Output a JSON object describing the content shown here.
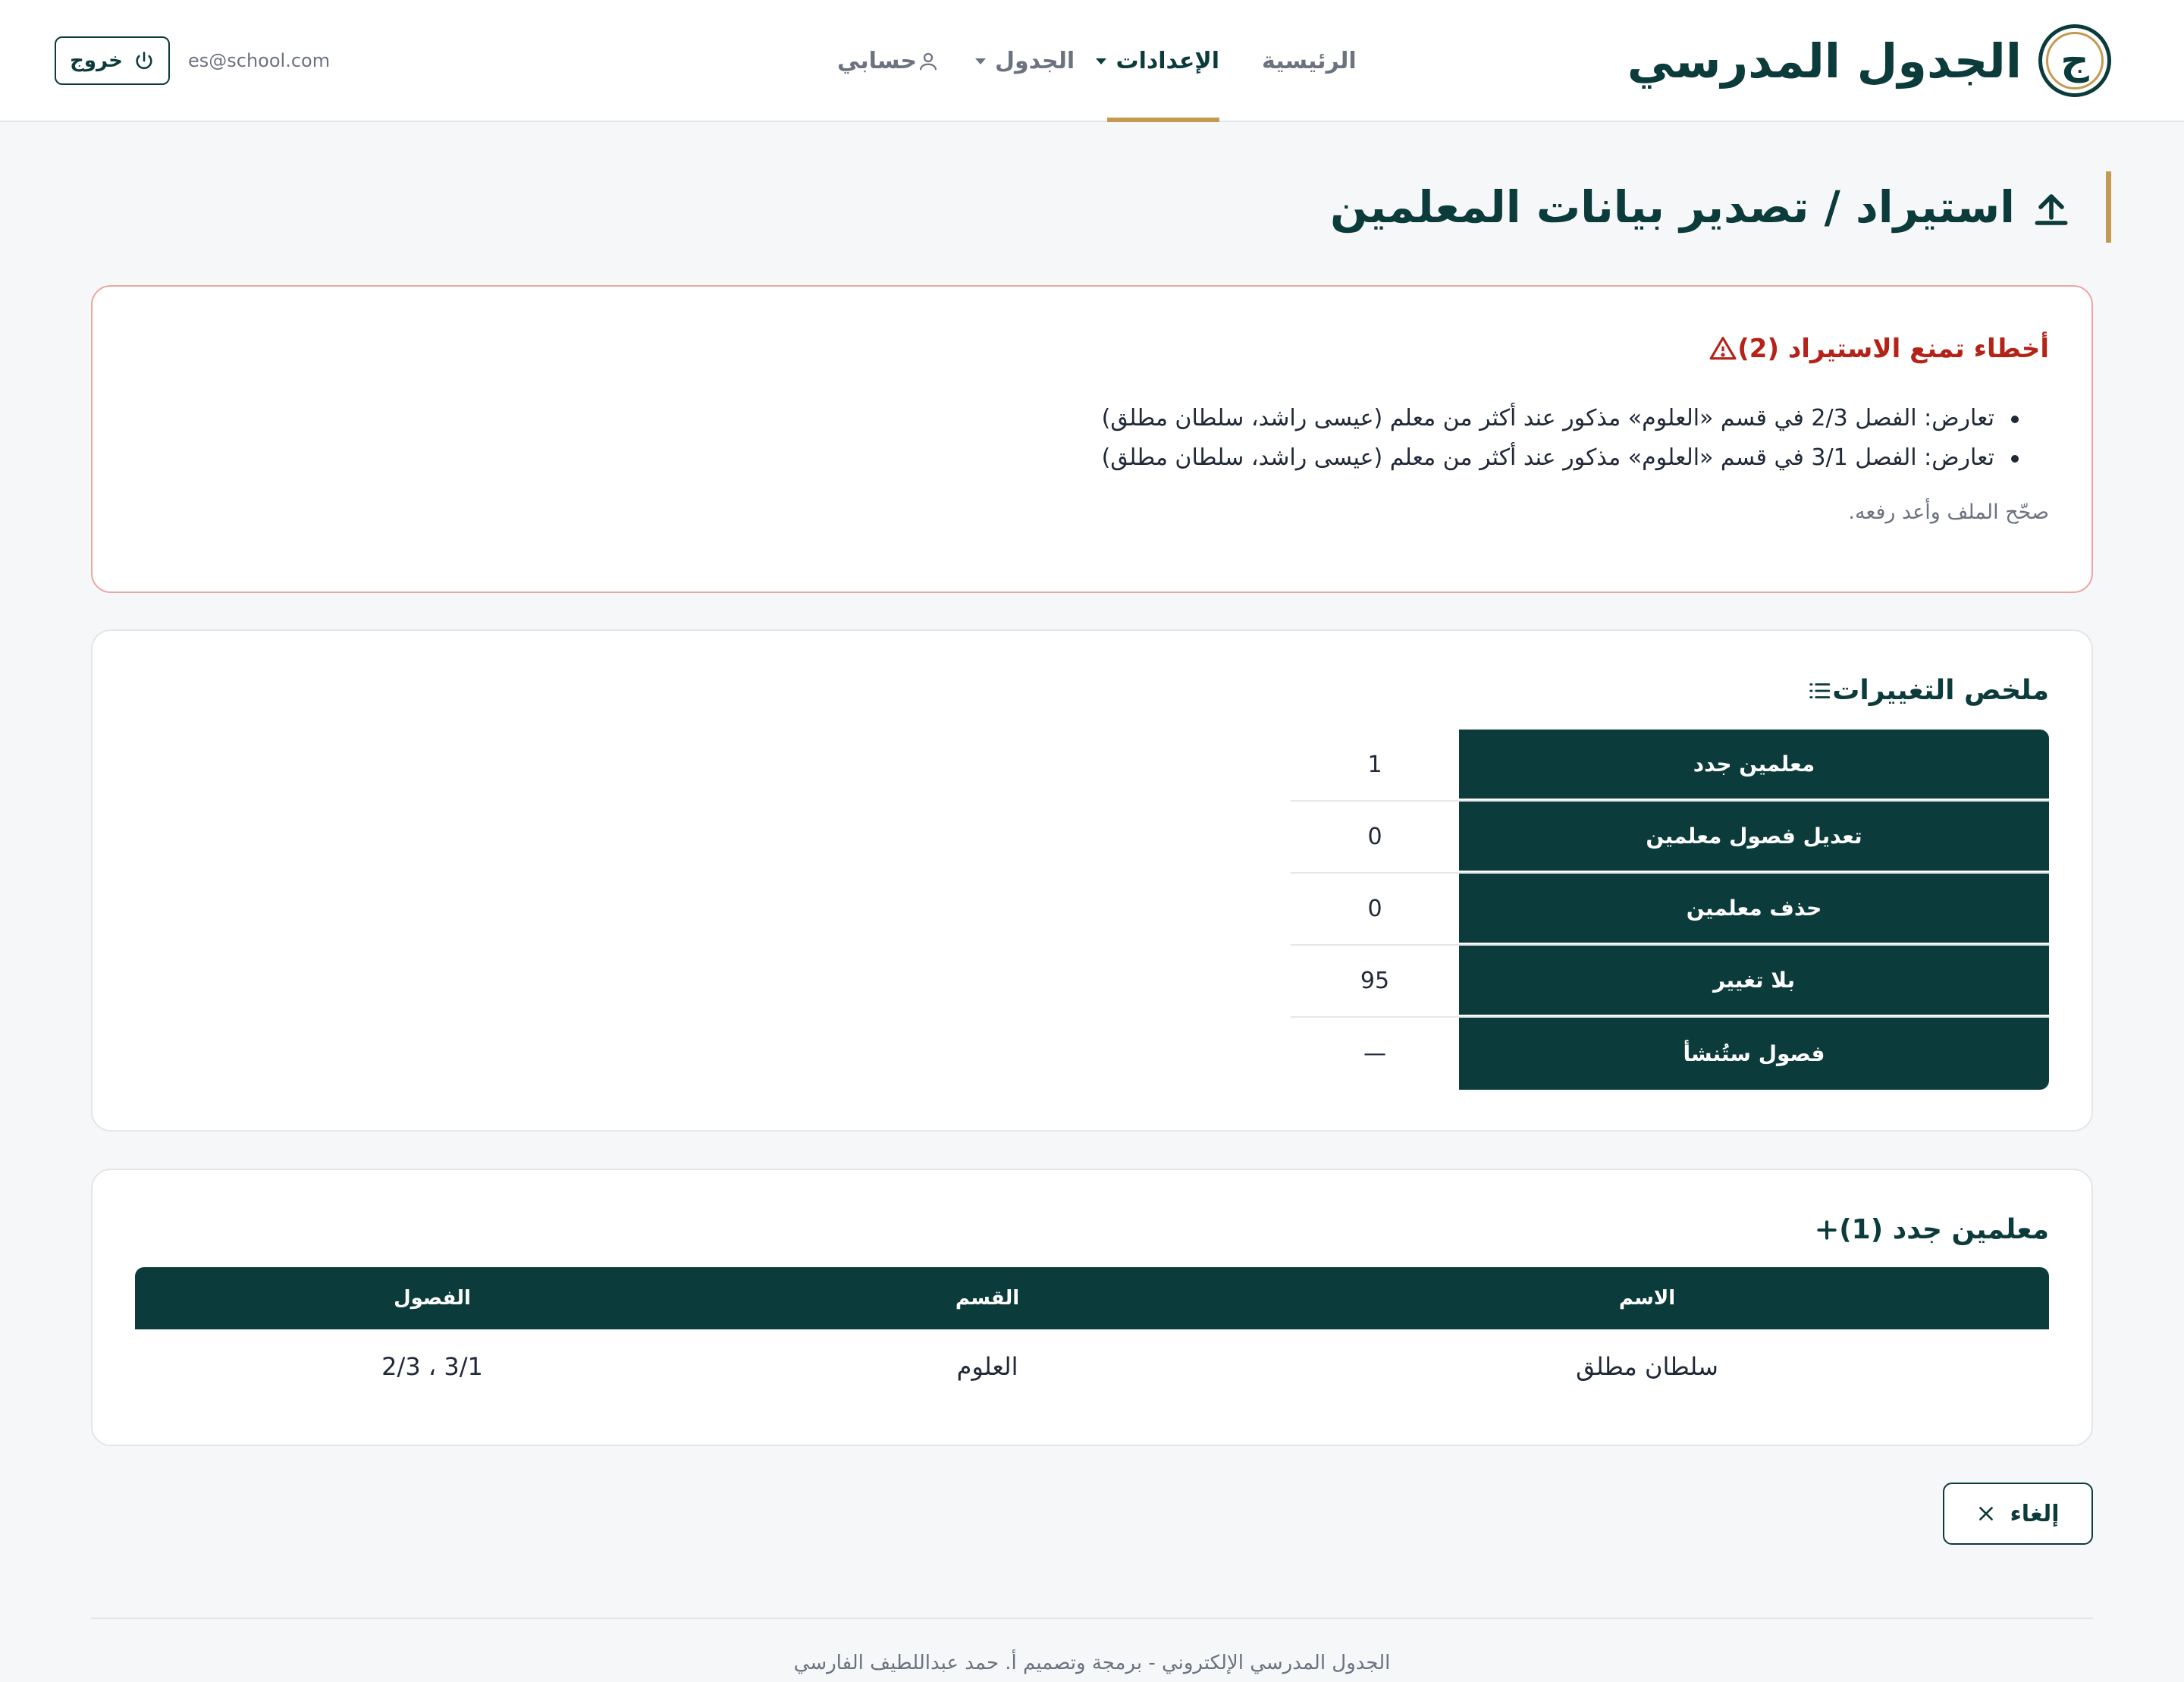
{
  "app": {
    "title": "الجدول المدرسي",
    "logo_letter": "ج"
  },
  "nav": {
    "home": "الرئيسية",
    "settings": "الإعدادات",
    "schedule": "الجدول",
    "account": "حسابي"
  },
  "user": {
    "email": "es@school.com",
    "logout_label": "خروج"
  },
  "page": {
    "title": "استيراد / تصدير بيانات المعلمين"
  },
  "errors": {
    "title": "أخطاء تمنع الاستيراد (2)",
    "items": [
      "تعارض: الفصل 2/3 في قسم «العلوم» مذكور عند أكثر من معلم (عيسى راشد، سلطان مطلق)",
      "تعارض: الفصل 3/1 في قسم «العلوم» مذكور عند أكثر من معلم (عيسى راشد، سلطان مطلق)"
    ],
    "hint": "صحّح الملف وأعد رفعه."
  },
  "summary": {
    "title": "ملخص التغييرات",
    "rows": [
      {
        "label": "معلمين جدد",
        "value": "1"
      },
      {
        "label": "تعديل فصول معلمين",
        "value": "0"
      },
      {
        "label": "حذف معلمين",
        "value": "0"
      },
      {
        "label": "بلا تغيير",
        "value": "95"
      },
      {
        "label": "فصول ستُنشأ",
        "value": "—"
      }
    ]
  },
  "new_teachers": {
    "title": "معلمين جدد (1)",
    "headers": {
      "name": "الاسم",
      "dept": "القسم",
      "classes": "الفصول"
    },
    "rows": [
      {
        "name": "سلطان مطلق",
        "dept": "العلوم",
        "classes": "3/1 ، 2/3"
      }
    ]
  },
  "actions": {
    "cancel_label": "إلغاء"
  },
  "footer": {
    "text": "الجدول المدرسي الإلكتروني - برمجة وتصميم أ. حمد عبداللطيف الفارسي"
  },
  "colors": {
    "primary": "#0b3b3a",
    "accent": "#c39a4f",
    "error": "#b42318",
    "muted": "#6b7280"
  }
}
